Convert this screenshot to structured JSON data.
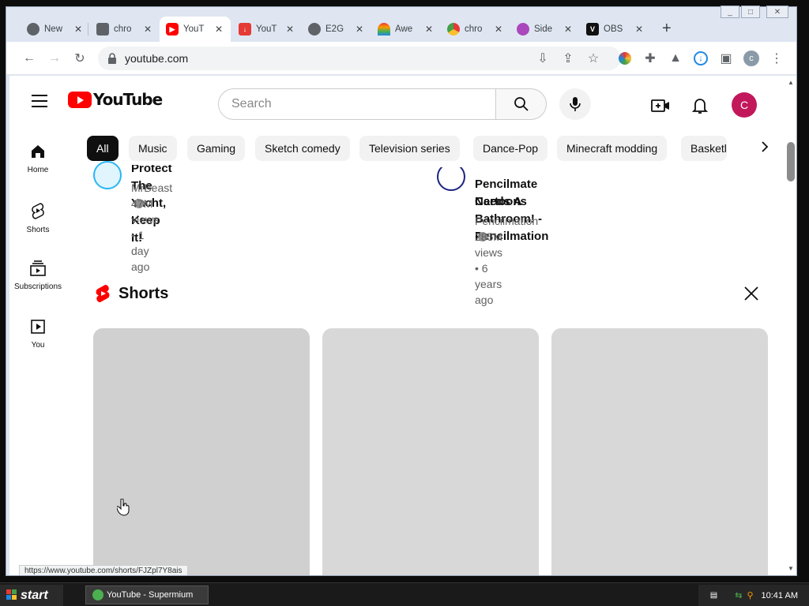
{
  "browser": {
    "tabs": [
      {
        "label": "New",
        "icon": "chrome-icon",
        "color": "#5f6368"
      },
      {
        "label": "chro",
        "icon": "mail-icon",
        "color": "#5f6368"
      },
      {
        "label": "YouT",
        "icon": "youtube-icon",
        "color": "#ff0000"
      },
      {
        "label": "YouT",
        "icon": "download-icon",
        "color": "#e53935"
      },
      {
        "label": "E2G",
        "icon": "globe-icon",
        "color": "#5f6368"
      },
      {
        "label": "Awe",
        "icon": "rainbow-icon",
        "color": "#ff9800"
      },
      {
        "label": "chro",
        "icon": "chrome-color-icon",
        "color": "#1e88e5"
      },
      {
        "label": "Side",
        "icon": "brain-icon",
        "color": "#9c27b0"
      },
      {
        "label": "OBS",
        "icon": "v-logo-icon",
        "color": "#111111"
      }
    ],
    "active_tab": 2,
    "new_tab_label": "+",
    "url": "youtube.com",
    "status_url": "https://www.youtube.com/shorts/FJZpl7Y8ais"
  },
  "youtube": {
    "logo_text": "YouTube",
    "search_placeholder": "Search",
    "avatar_letter": "C",
    "avatar_color": "#c2185b",
    "sidebar": [
      {
        "label": "Home",
        "icon": "home-icon"
      },
      {
        "label": "Shorts",
        "icon": "shorts-icon"
      },
      {
        "label": "Subscriptions",
        "icon": "subscriptions-icon"
      },
      {
        "label": "You",
        "icon": "you-icon"
      }
    ],
    "chips": [
      "All",
      "Music",
      "Gaming",
      "Sketch comedy",
      "Television series",
      "Dance-Pop",
      "Minecraft modding",
      "Basketl"
    ],
    "videos": [
      {
        "title": "Protect The Yacht, Keep It!",
        "channel": "MrBeast",
        "meta": "47M views • 1 day ago"
      },
      {
        "title_line1": "Pencilmate Needs A Bathroom! - Pencilmation",
        "title_line2": "Cartoons",
        "channel": "Pencilmation",
        "meta": "285M views • 6 years ago"
      }
    ],
    "shorts_title": "Shorts"
  },
  "taskbar": {
    "start_label": "start",
    "task_label": "YouTube - Supermium",
    "clock": "10:41 AM"
  }
}
